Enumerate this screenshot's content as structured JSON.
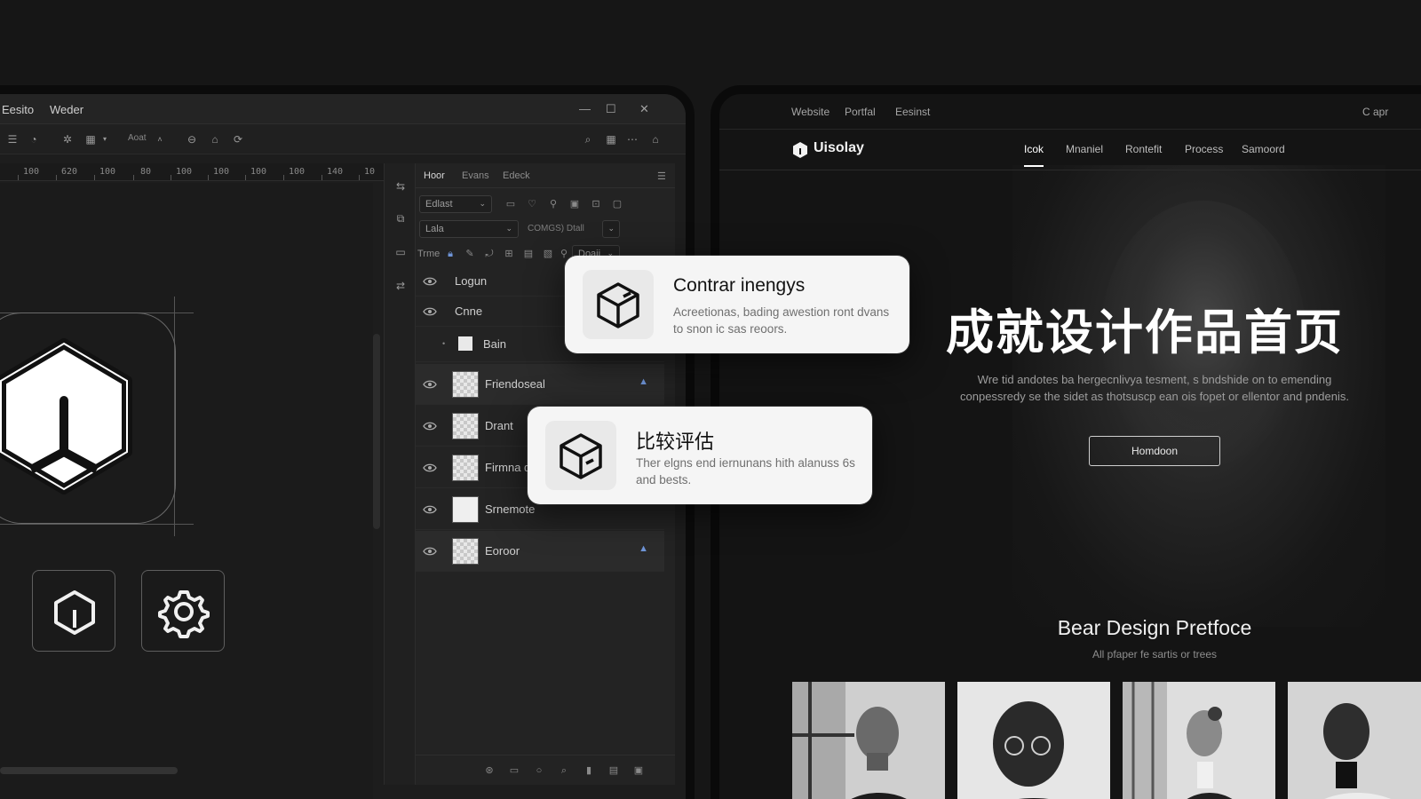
{
  "editor": {
    "title_left": "Eesito",
    "title_right": "Weder",
    "toolbar_dropdown": "Aoat",
    "ruler_ticks": [
      "100",
      "620",
      "100",
      "80",
      "100",
      "100",
      "100",
      "100",
      "140",
      "10"
    ],
    "panel_tabs": [
      "Hoor",
      "Evans",
      "Edeck"
    ],
    "blend_dropdown": "Edlast",
    "opacity_dropdown": "Lala",
    "opacity_text": "COMGS) Dtall",
    "lock_label": "Trme",
    "lock_dropdown": "Doaii",
    "layers": [
      {
        "name": "Logun",
        "visible": true,
        "thumb": "none"
      },
      {
        "name": "Cnne",
        "visible": true,
        "thumb": "none"
      },
      {
        "name": "Bain",
        "visible": false,
        "thumb": "solid"
      },
      {
        "name": "Friendoseal",
        "visible": true,
        "thumb": "checker",
        "badge": true
      },
      {
        "name": "Drant",
        "visible": true,
        "thumb": "checker"
      },
      {
        "name": "Firmna d",
        "visible": true,
        "thumb": "checker"
      },
      {
        "name": "Srnemote",
        "visible": true,
        "thumb": "solid"
      },
      {
        "name": "Eoroor",
        "visible": true,
        "thumb": "checker",
        "badge": true
      }
    ]
  },
  "website": {
    "topbar": [
      "Website",
      "Portfal",
      "Eesinst"
    ],
    "topbar_right": "C apr",
    "brand": "Uisolay",
    "nav": [
      "Icok",
      "Mnaniel",
      "Rontefit",
      "Process",
      "Samoord"
    ],
    "hero_title": "成就设计作品首页",
    "hero_desc": "Wre tid andotes ba hergecnlivya tesment, s bndshide on to emending conpessredy se the sidet as thotsuscp ean ois fopet or ellentor and pndenis.",
    "hero_button": "Homdoon",
    "section_title": "Bear Design Pretfoce",
    "section_sub": "All pfaper fe sartis or trees"
  },
  "cards": [
    {
      "title": "Contrar inengys",
      "body": "Acreetionas, bading awestion ront dvans to snon ic sas reoors."
    },
    {
      "title": "比较评估",
      "body": "Ther elgns end iernunans hith alanuss 6s and bests."
    }
  ],
  "colors": {
    "accent_badge": "#6f95d8",
    "card_bg": "#f5f5f5",
    "window_bg": "#1d1d1d"
  }
}
